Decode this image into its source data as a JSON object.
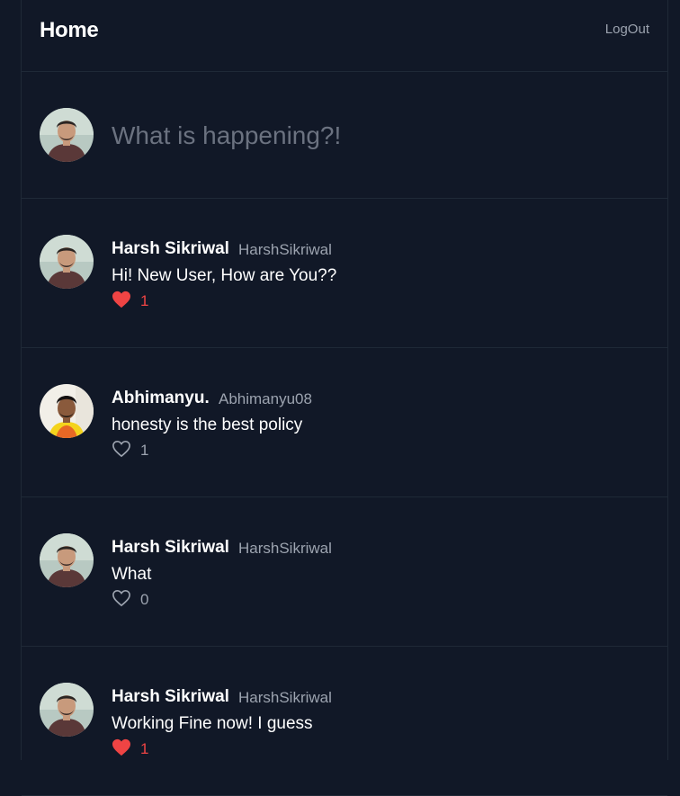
{
  "header": {
    "title": "Home",
    "logout_label": "LogOut"
  },
  "compose": {
    "placeholder": "What is happening?!"
  },
  "posts": [
    {
      "name": "Harsh Sikriwal",
      "handle": "HarshSikriwal",
      "text": "Hi! New User, How are You??",
      "likes": "1",
      "liked": true,
      "avatar": "avatar-harsh"
    },
    {
      "name": "Abhimanyu.",
      "handle": "Abhimanyu08",
      "text": "honesty is the best policy",
      "likes": "1",
      "liked": false,
      "avatar": "avatar-abhimanyu"
    },
    {
      "name": "Harsh Sikriwal",
      "handle": "HarshSikriwal",
      "text": "What",
      "likes": "0",
      "liked": false,
      "avatar": "avatar-harsh"
    },
    {
      "name": "Harsh Sikriwal",
      "handle": "HarshSikriwal",
      "text": "Working Fine now! I guess",
      "likes": "1",
      "liked": true,
      "avatar": "avatar-harsh"
    }
  ],
  "colors": {
    "background": "#111827",
    "border": "#1f2937",
    "like_red": "#ef4444",
    "muted": "#9ca3af"
  }
}
